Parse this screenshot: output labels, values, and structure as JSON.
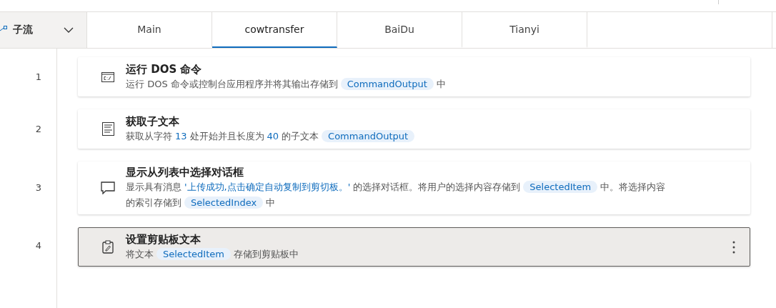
{
  "subflow_selector": {
    "label": "子流"
  },
  "tabs": [
    {
      "label": "Main",
      "selected": false
    },
    {
      "label": "cowtransfer",
      "selected": true
    },
    {
      "label": "BaiDu",
      "selected": false
    },
    {
      "label": "Tianyi",
      "selected": false
    }
  ],
  "actions": [
    {
      "number": "1",
      "kind": "console",
      "title": "运行 DOS 命令",
      "selected": false,
      "description": [
        {
          "kind": "text",
          "text": "运行 DOS 命令或控制台应用程序并将其输出存储到"
        },
        {
          "kind": "variable",
          "text": "CommandOutput"
        },
        {
          "kind": "text",
          "text": "中"
        }
      ]
    },
    {
      "number": "2",
      "kind": "text",
      "title": "获取子文本",
      "selected": false,
      "description": [
        {
          "kind": "text",
          "text": "获取从字符"
        },
        {
          "kind": "literal",
          "text": "13"
        },
        {
          "kind": "text",
          "text": "处开始并且长度为"
        },
        {
          "kind": "literal",
          "text": "40"
        },
        {
          "kind": "text",
          "text": "的子文本"
        },
        {
          "kind": "variable",
          "text": "CommandOutput"
        }
      ]
    },
    {
      "number": "3",
      "kind": "message",
      "title": "显示从列表中选择对话框",
      "selected": false,
      "description": [
        {
          "kind": "text",
          "text": "显示具有消息"
        },
        {
          "kind": "literal",
          "text": "'上传成功,点击确定自动复制到剪切板。'"
        },
        {
          "kind": "text",
          "text": "的选择对话框。将用户的选择内容存储到"
        },
        {
          "kind": "variable",
          "text": "SelectedItem"
        },
        {
          "kind": "text",
          "text": "中。将选择内容的索引存储到"
        },
        {
          "kind": "variable",
          "text": "SelectedIndex"
        },
        {
          "kind": "text",
          "text": "中"
        }
      ]
    },
    {
      "number": "4",
      "kind": "clipboard",
      "title": "设置剪贴板文本",
      "selected": true,
      "description": [
        {
          "kind": "text",
          "text": "将文本"
        },
        {
          "kind": "variable",
          "text": "SelectedItem"
        },
        {
          "kind": "text",
          "text": "存储到剪贴板中"
        }
      ]
    }
  ]
}
